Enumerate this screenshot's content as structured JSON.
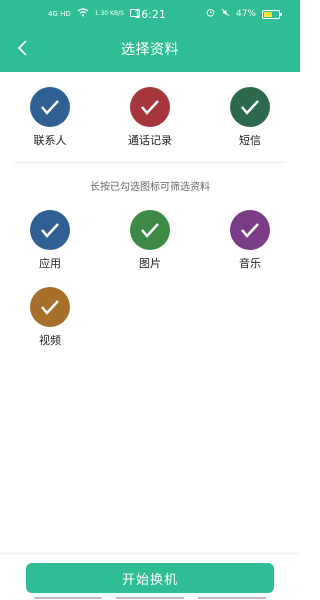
{
  "status": {
    "signal": "4G HD",
    "speed": "1.30 KB/S",
    "time": "16:21",
    "battery_percent": "47%"
  },
  "header": {
    "title": "选择资料"
  },
  "top_items": [
    {
      "label": "联系人",
      "color": "#2f5f93",
      "icon": "contacts-icon"
    },
    {
      "label": "通话记录",
      "color": "#a5363b",
      "icon": "call-log-icon"
    },
    {
      "label": "短信",
      "color": "#2d6a4d",
      "icon": "sms-icon"
    }
  ],
  "hint": "长按已勾选图标可筛选资料",
  "media_items": [
    {
      "label": "应用",
      "color": "#2f5f93",
      "icon": "apps-icon"
    },
    {
      "label": "图片",
      "color": "#3c8a46",
      "icon": "images-icon"
    },
    {
      "label": "音乐",
      "color": "#7a3c86",
      "icon": "music-icon"
    },
    {
      "label": "视频",
      "color": "#a86f2a",
      "icon": "video-icon"
    }
  ],
  "footer": {
    "start_label": "开始换机"
  }
}
